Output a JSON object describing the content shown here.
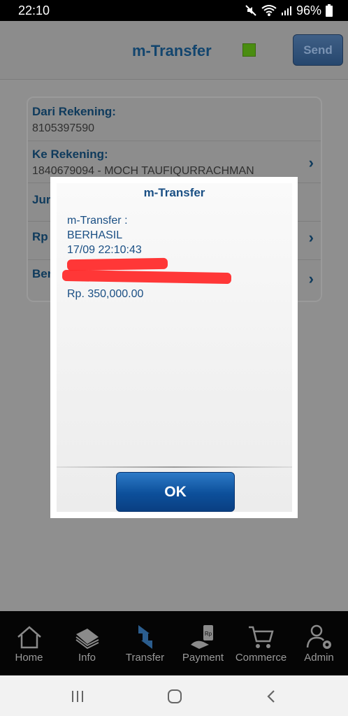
{
  "status_bar": {
    "time": "22:10",
    "battery": "96%"
  },
  "header": {
    "title": "m-Transfer",
    "send_label": "Send",
    "status_color": "#4a8d10"
  },
  "form": {
    "from_label": "Dari Rekening:",
    "from_value": "8105397590",
    "to_label": "Ke Rekening:",
    "to_value": "1840679094 - MOCH TAUFIQURRACHMAN",
    "row3_label_partial": "Jur",
    "row4_label_partial": "Rp",
    "row5_label_partial": "Ber"
  },
  "dialog": {
    "title": "m-Transfer",
    "lines": [
      "m-Transfer :",
      "BERHASIL",
      "17/09 22:10:43"
    ],
    "amount": "Rp. 350,000.00",
    "ok_label": "OK"
  },
  "bottom_nav": {
    "items": [
      {
        "label": "Home",
        "icon": "home-icon"
      },
      {
        "label": "Info",
        "icon": "info-book-icon"
      },
      {
        "label": "Transfer",
        "icon": "transfer-icon"
      },
      {
        "label": "Payment",
        "icon": "payment-icon"
      },
      {
        "label": "Commerce",
        "icon": "cart-icon"
      },
      {
        "label": "Admin",
        "icon": "admin-icon"
      }
    ]
  },
  "colors": {
    "accent": "#1a4f84",
    "ok_button": "#0c4f9a",
    "redaction": "#ff2626"
  }
}
